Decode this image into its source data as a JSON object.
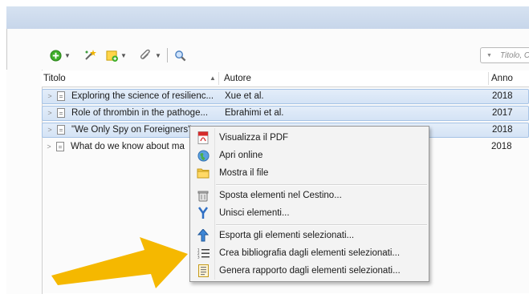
{
  "toolbar": {
    "search_placeholder": "Titolo, C"
  },
  "table": {
    "columns": {
      "title": "Titolo",
      "author": "Autore",
      "year": "Anno"
    },
    "rows": [
      {
        "title": "Exploring the science of resilienc...",
        "author": "Xue et al.",
        "year": "2018",
        "selected": true
      },
      {
        "title": "Role of thrombin in the pathoge...",
        "author": "Ebrahimi et al.",
        "year": "2017",
        "selected": true
      },
      {
        "title": "\"We Only Spy on Foreigners\"",
        "author": "",
        "year": "2018",
        "selected": true
      },
      {
        "title": "What do we know about ma",
        "author": "",
        "year": "2018",
        "selected": false
      }
    ]
  },
  "context_menu": {
    "items": [
      {
        "label": "Visualizza il PDF",
        "icon": "pdf-icon"
      },
      {
        "label": "Apri online",
        "icon": "globe-icon"
      },
      {
        "label": "Mostra il file",
        "icon": "folder-icon"
      },
      {
        "label": "Sposta elementi nel Cestino...",
        "icon": "trash-icon"
      },
      {
        "label": "Unisci elementi...",
        "icon": "merge-icon"
      },
      {
        "label": "Esporta gli elementi selezionati...",
        "icon": "export-icon"
      },
      {
        "label": "Crea bibliografia dagli elementi selezionati...",
        "icon": "bibliography-icon"
      },
      {
        "label": "Genera rapporto dagli elementi selezionati...",
        "icon": "report-icon"
      }
    ]
  },
  "colors": {
    "selection": "#d4e3f5",
    "arrow": "#f5b800"
  }
}
